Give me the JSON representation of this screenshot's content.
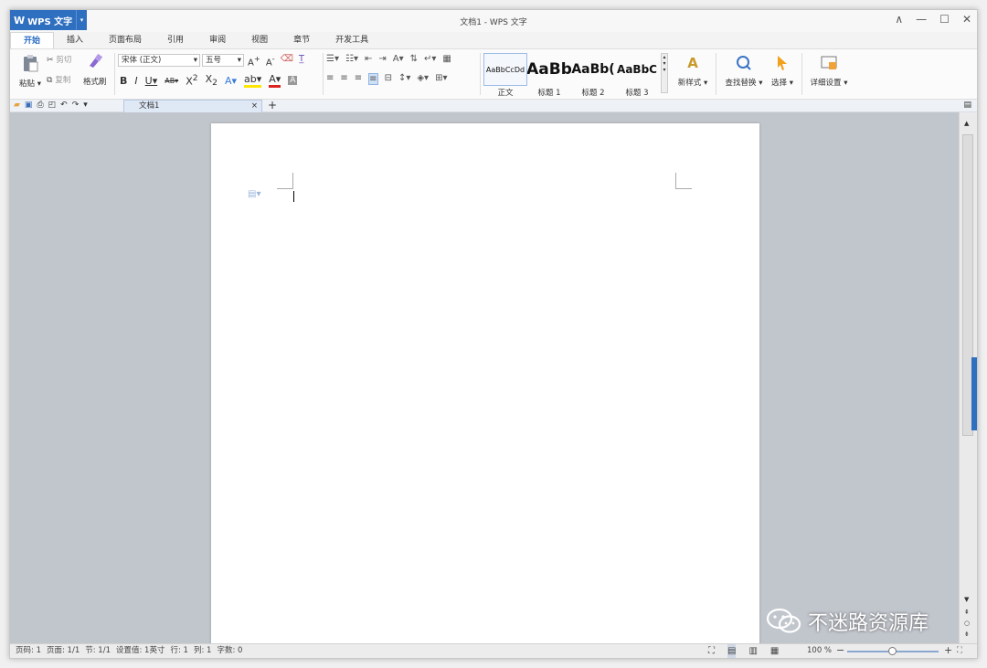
{
  "app": {
    "name": "WPS 文字",
    "logo": "W",
    "window_title": "文档1 - WPS 文字"
  },
  "window_controls": [
    "∧",
    "—",
    "☐",
    "✕"
  ],
  "tabs": [
    "开始",
    "插入",
    "页面布局",
    "引用",
    "审阅",
    "视图",
    "章节",
    "开发工具"
  ],
  "clipboard": {
    "paste": "粘贴",
    "cut": "剪切",
    "copy": "复制",
    "format_painter": "格式刷"
  },
  "font": {
    "name": "宋体 (正文)",
    "size": "五号"
  },
  "styles": [
    {
      "preview": "AaBbCcDd",
      "label": "正文"
    },
    {
      "preview": "AaBb",
      "label": "标题 1"
    },
    {
      "preview": "AaBb(",
      "label": "标题 2"
    },
    {
      "preview": "AaBbC",
      "label": "标题 3"
    }
  ],
  "commands": {
    "new_style": "新样式",
    "find_replace": "查找替换",
    "select": "选择",
    "detail_settings": "详细设置"
  },
  "doc_tab": {
    "name": "文档1",
    "close": "×",
    "add": "+"
  },
  "status": {
    "page_num": "页码: 1",
    "pages": "页面: 1/1",
    "section": "节: 1/1",
    "position": "设置值: 1英寸",
    "row": "行: 1",
    "col": "列: 1",
    "words": "字数: 0",
    "zoom": "100 %",
    "zoom_fraction": 0.5
  },
  "watermark": "不迷路资源库"
}
